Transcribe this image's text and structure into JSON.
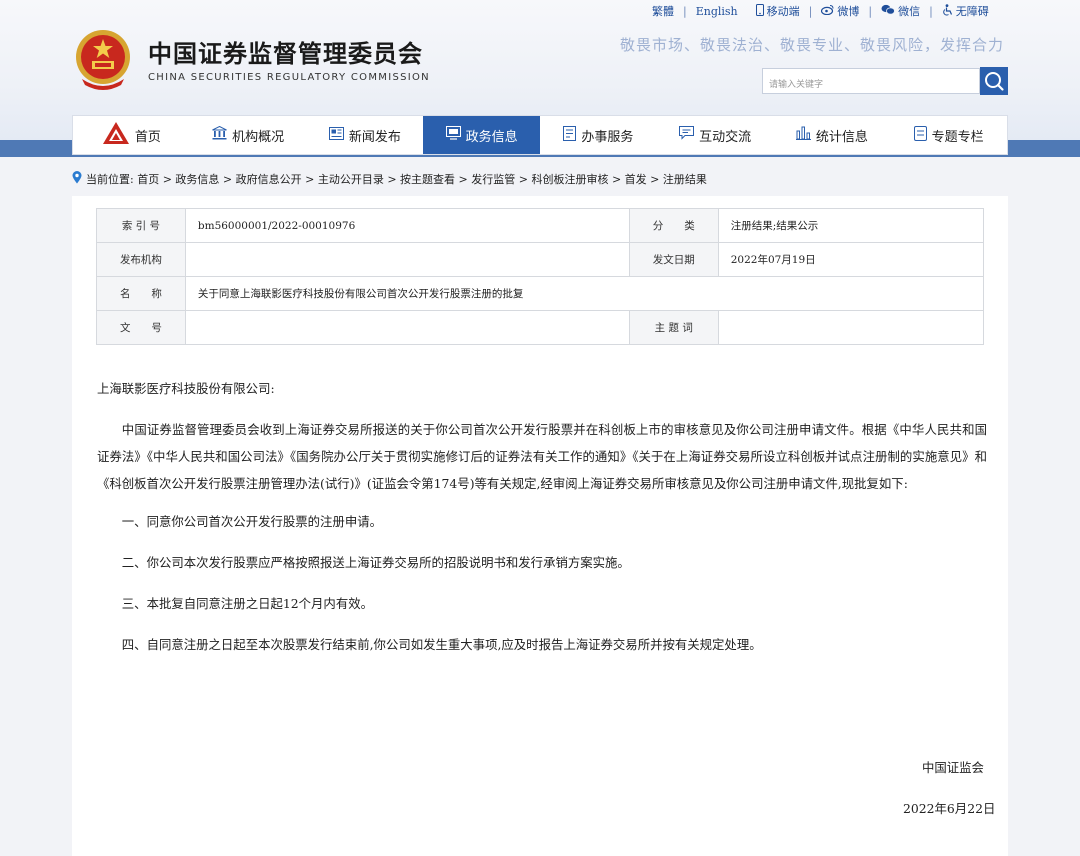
{
  "header": {
    "title": "中国证券监督管理委员会",
    "subtitle": "CHINA SECURITIES REGULATORY COMMISSION",
    "slogan": "敬畏市场、敬畏法治、敬畏专业、敬畏风险，发挥合力",
    "search_placeholder": "请输入关键字",
    "toplinks": [
      "繁體",
      "English",
      "移动端",
      "微博",
      "微信",
      "无障碍"
    ]
  },
  "nav": {
    "items": [
      "首页",
      "机构概况",
      "新闻发布",
      "政务信息",
      "办事服务",
      "互动交流",
      "统计信息",
      "专题专栏"
    ],
    "active": "政务信息"
  },
  "breadcrumb": "当前位置:  首页 > 政务信息 > 政府信息公开 > 主动公开目录 > 按主题查看 > 发行监管 > 科创板注册审核 > 首发 > 注册结果",
  "meta": {
    "index_label": "索 引 号",
    "index_value": "bm56000001/2022-00010976",
    "category_label": "分　　类",
    "category_value": "注册结果;结果公示",
    "publisher_label": "发布机构",
    "publisher_value": "",
    "date_label": "发文日期",
    "date_value": "2022年07月19日",
    "name_label": "名　　称",
    "name_value": "关于同意上海联影医疗科技股份有限公司首次公开发行股票注册的批复",
    "docno_label": "文　　号",
    "docno_value": "",
    "keywords_label": "主 题 词",
    "keywords_value": ""
  },
  "letter": {
    "salutation": "上海联影医疗科技股份有限公司:",
    "body": "中国证券监督管理委员会收到上海证券交易所报送的关于你公司首次公开发行股票并在科创板上市的审核意见及你公司注册申请文件。根据《中华人民共和国证券法》《中华人民共和国公司法》《国务院办公厅关于贯彻实施修订后的证券法有关工作的通知》《关于在上海证券交易所设立科创板并试点注册制的实施意见》和《科创板首次公开发行股票注册管理办法(试行)》(证监会令第174号)等有关规定,经审阅上海证券交易所审核意见及你公司注册申请文件,现批复如下:",
    "items": [
      "一、同意你公司首次公开发行股票的注册申请。",
      "二、你公司本次发行股票应严格按照报送上海证券交易所的招股说明书和发行承销方案实施。",
      "三、本批复自同意注册之日起12个月内有效。",
      "四、自同意注册之日起至本次股票发行结束前,你公司如发生重大事项,应及时报告上海证券交易所并按有关规定处理。"
    ],
    "signature": "中国证监会",
    "sign_date": "2022年6月22日"
  }
}
